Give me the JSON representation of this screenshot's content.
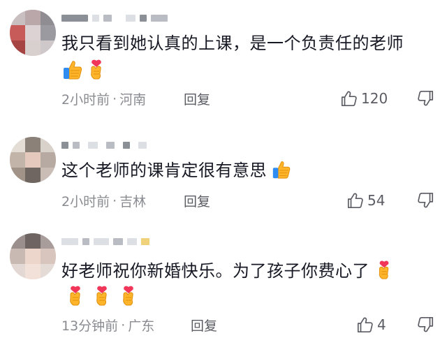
{
  "comments": [
    {
      "text": "我只看到她认真的上课，是一个负责任的老师",
      "emoji_line": [
        "thumbs-up",
        "finger-heart"
      ],
      "time": "2小时前",
      "location": "河南",
      "reply_label": "回复",
      "likes": "120"
    },
    {
      "text": "这个老师的课肯定很有意思",
      "emoji_inline": [
        "thumbs-up"
      ],
      "time": "2小时前",
      "location": "吉林",
      "reply_label": "回复",
      "likes": "54"
    },
    {
      "text": "好老师祝你新婚快乐。为了孩子你费心了",
      "emoji_inline": [
        "finger-heart"
      ],
      "emoji_line": [
        "finger-heart",
        "finger-heart",
        "finger-heart"
      ],
      "time": "13分钟前",
      "location": "广东",
      "reply_label": "回复",
      "likes": "4"
    }
  ],
  "separator": "·",
  "colors": {
    "text_primary": "#161823",
    "text_meta": "#8a8b91",
    "icon": "#5b5c63"
  }
}
